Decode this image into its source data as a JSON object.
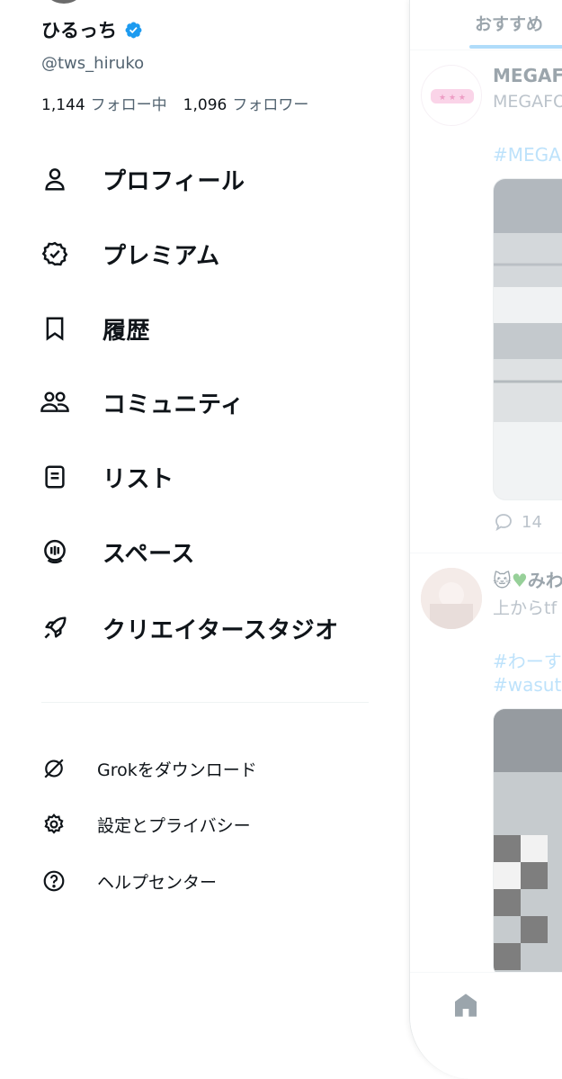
{
  "profile": {
    "display_name": "ひるっち",
    "handle": "@tws_hiruko",
    "following_count": "1,144",
    "following_label": "フォロー中",
    "followers_count": "1,096",
    "followers_label": "フォロワー",
    "verified_color": "#1d9bf0"
  },
  "menu": {
    "items": [
      {
        "label": "プロフィール",
        "icon": "person-icon"
      },
      {
        "label": "プレミアム",
        "icon": "verified-badge-icon"
      },
      {
        "label": "履歴",
        "icon": "bookmark-icon"
      },
      {
        "label": "コミュニティ",
        "icon": "people-icon"
      },
      {
        "label": "リスト",
        "icon": "list-icon"
      },
      {
        "label": "スペース",
        "icon": "microphone-icon"
      },
      {
        "label": "クリエイタースタジオ",
        "icon": "rocket-icon"
      }
    ]
  },
  "settings": {
    "items": [
      {
        "label": "Grokをダウンロード",
        "icon": "grok-icon"
      },
      {
        "label": "設定とプライバシー",
        "icon": "gear-icon"
      },
      {
        "label": "ヘルプセンター",
        "icon": "help-icon"
      }
    ]
  },
  "timeline": {
    "tab_label": "おすすめ",
    "posts": [
      {
        "name": "MEGAF",
        "sub": "MEGAFO",
        "tags": [
          "#MEGA"
        ],
        "reply_count": "14"
      },
      {
        "name": "みわ",
        "sub": "上からtf",
        "tags": [
          "#わーす",
          "#wasuta"
        ]
      }
    ]
  },
  "colors": {
    "accent": "#1d9bf0",
    "text_primary": "#0f1419",
    "text_secondary": "#536471"
  }
}
